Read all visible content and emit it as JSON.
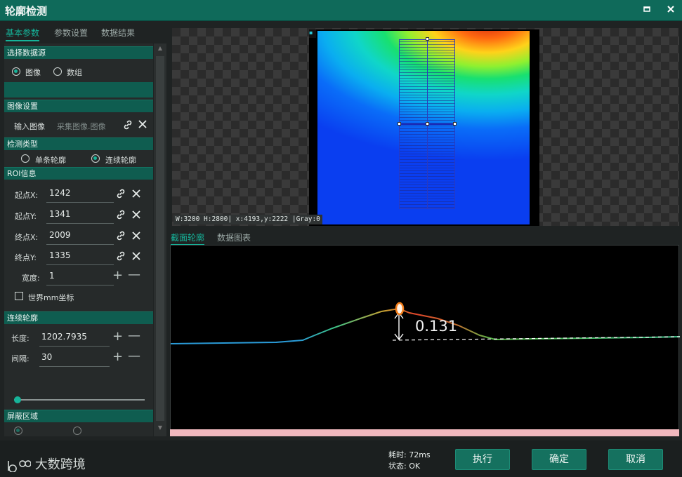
{
  "window": {
    "title": "轮廓检测",
    "maximize_icon": "maximize-icon",
    "close_icon": "close-icon"
  },
  "left_tabs": [
    "基本参数",
    "参数设置",
    "数据结果"
  ],
  "sections": {
    "data_source": {
      "title": "选择数据源",
      "options": [
        "图像",
        "数组"
      ],
      "selected": "图像"
    },
    "image_settings": {
      "title": "图像设置",
      "input_label": "输入图像",
      "input_value": "采集图像.图像"
    },
    "detection_type": {
      "title": "检测类型",
      "options": [
        "单条轮廓",
        "连续轮廓"
      ],
      "selected": "连续轮廓"
    },
    "roi": {
      "title": "ROI信息",
      "fields": [
        {
          "label": "起点X:",
          "value": "1242"
        },
        {
          "label": "起点Y:",
          "value": "1341"
        },
        {
          "label": "终点X:",
          "value": "2009"
        },
        {
          "label": "终点Y:",
          "value": "1335"
        }
      ],
      "width_label": "宽度:",
      "width_value": "1",
      "world_checkbox": "世界mm坐标",
      "world_checked": false
    },
    "continuous": {
      "title": "连续轮廓",
      "length_label": "长度:",
      "length_value": "1202.7935",
      "interval_label": "间隔:",
      "interval_value": "30",
      "slider_level": 0
    },
    "mask": {
      "title": "屏蔽区域"
    }
  },
  "viewer": {
    "status": "W:3200 H:2800| x:4193,y:2222 |Gray:0"
  },
  "sub_tabs": [
    "截面轮廓",
    "数据图表"
  ],
  "profile": {
    "measurement": "0.131"
  },
  "footer": {
    "logo_text": "大数跨境",
    "time_label": "耗时: 72ms",
    "state_label": "状态: OK",
    "buttons": {
      "run": "执行",
      "ok": "确定",
      "cancel": "取消"
    }
  },
  "colors": {
    "accent": "#15b49a",
    "header": "#0f6a5a",
    "button": "#15715f"
  }
}
